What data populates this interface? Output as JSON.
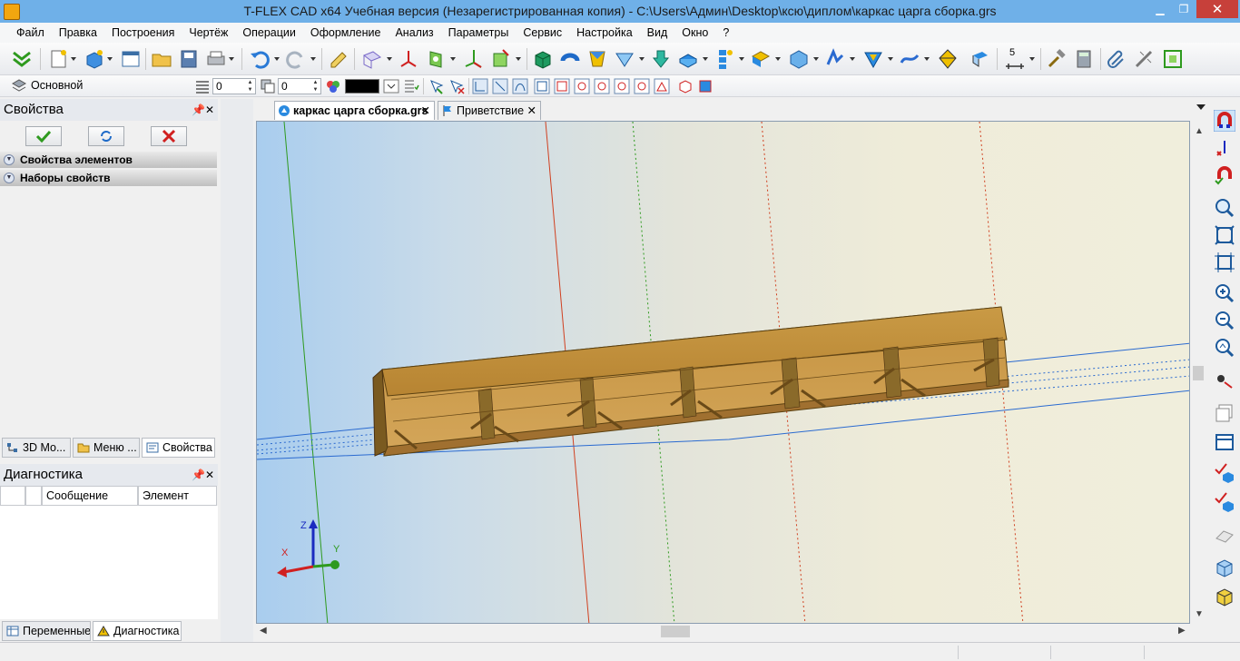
{
  "window": {
    "title": "T-FLEX CAD x64 Учебная версия (Незарегистрированная копия) - C:\\Users\\Админ\\Desktop\\ксю\\диплом\\каркас царга сборка.grs",
    "minimize": "▁",
    "maximize": "❐",
    "close": "✕"
  },
  "menu": [
    "Файл",
    "Правка",
    "Построения",
    "Чертёж",
    "Операции",
    "Оформление",
    "Анализ",
    "Параметры",
    "Сервис",
    "Настройка",
    "Вид",
    "Окно",
    "?"
  ],
  "toolbar2": {
    "layer_name": "Основной",
    "level_value": "0",
    "priority_value": "0",
    "color_value": "#000000"
  },
  "toolbar1": {
    "dimension_step": "5"
  },
  "properties_panel": {
    "title": "Свойства",
    "ok_icon": "checkmark-icon",
    "refresh_icon": "refresh-icon",
    "cancel_icon": "cross-icon",
    "sections": [
      "Свойства элементов",
      "Наборы свойств"
    ],
    "tabs": [
      "3D Мо...",
      "Меню ...",
      "Свойства"
    ]
  },
  "diagnostics_panel": {
    "title": "Диагностика",
    "columns": [
      "",
      "",
      "Сообщение",
      "Элемент"
    ],
    "tabs": [
      "Переменные",
      "Диагностика"
    ]
  },
  "document_tabs": [
    {
      "label": "каркас царга сборка.grs",
      "active": true
    },
    {
      "label": "Приветствие",
      "active": false
    }
  ],
  "axes": {
    "x": "X",
    "y": "Y",
    "z": "Z"
  },
  "colors": {
    "titlebar": "#6fb0e8",
    "close": "#c7403a",
    "wood": "#c8963e",
    "wood_dark": "#8a6a2a"
  }
}
